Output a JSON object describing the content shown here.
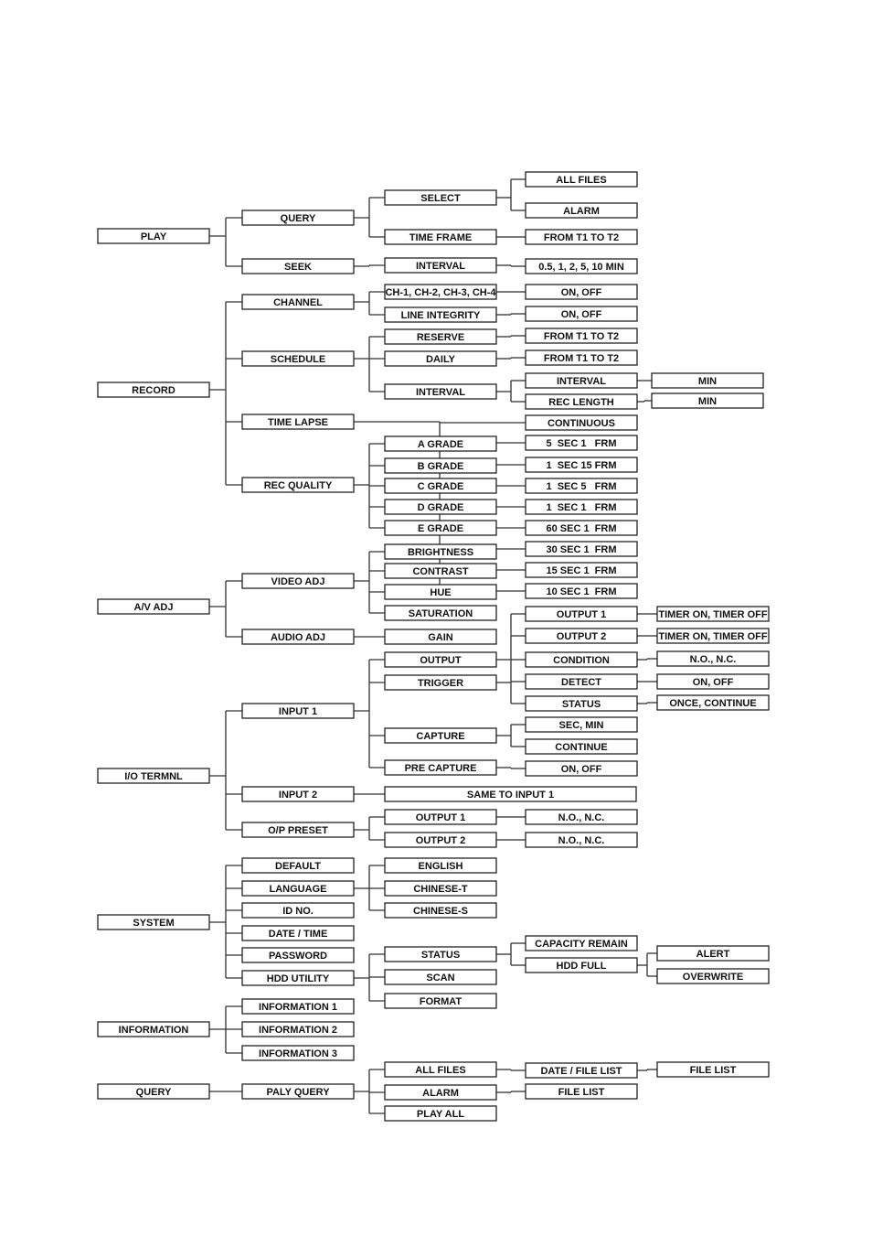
{
  "diagram": {
    "type": "menu-tree",
    "nodes": [
      {
        "id": "play",
        "label": "PLAY",
        "parent": null
      },
      {
        "id": "p_query",
        "label": "QUERY",
        "parent": "play"
      },
      {
        "id": "p_seek",
        "label": "SEEK",
        "parent": "play"
      },
      {
        "id": "p_select",
        "label": "SELECT",
        "parent": "p_query"
      },
      {
        "id": "p_timeframe",
        "label": "TIME FRAME",
        "parent": "p_query"
      },
      {
        "id": "p_allfiles",
        "label": "ALL FILES",
        "parent": "p_select"
      },
      {
        "id": "p_alarm",
        "label": "ALARM",
        "parent": "p_select"
      },
      {
        "id": "p_t1t2",
        "label": "FROM T1 TO T2",
        "parent": "p_timeframe"
      },
      {
        "id": "p_interval",
        "label": "INTERVAL",
        "parent": "p_seek"
      },
      {
        "id": "p_intv",
        "label": "0.5, 1, 2, 5, 10 MIN",
        "parent": "p_interval"
      },
      {
        "id": "record",
        "label": "RECORD",
        "parent": null
      },
      {
        "id": "r_channel",
        "label": "CHANNEL",
        "parent": "record"
      },
      {
        "id": "r_schedule",
        "label": "SCHEDULE",
        "parent": "record"
      },
      {
        "id": "r_timelapse",
        "label": "TIME LAPSE",
        "parent": "record"
      },
      {
        "id": "r_recq",
        "label": "REC QUALITY",
        "parent": "record"
      },
      {
        "id": "r_ch",
        "label": "CH-1, CH-2, CH-3, CH-4",
        "parent": "r_channel"
      },
      {
        "id": "r_line",
        "label": "LINE INTEGRITY",
        "parent": "r_channel"
      },
      {
        "id": "r_chonoff",
        "label": "ON, OFF",
        "parent": "r_ch"
      },
      {
        "id": "r_lineonoff",
        "label": "ON, OFF",
        "parent": "r_line"
      },
      {
        "id": "r_reserve",
        "label": "RESERVE",
        "parent": "r_schedule"
      },
      {
        "id": "r_daily",
        "label": "DAILY",
        "parent": "r_schedule"
      },
      {
        "id": "r_sint",
        "label": "INTERVAL",
        "parent": "r_schedule"
      },
      {
        "id": "r_reservet",
        "label": "FROM T1 TO T2",
        "parent": "r_reserve"
      },
      {
        "id": "r_dailyt",
        "label": "FROM T1 TO T2",
        "parent": "r_daily"
      },
      {
        "id": "r_iint",
        "label": "INTERVAL",
        "parent": "r_sint"
      },
      {
        "id": "r_ireclen",
        "label": "REC LENGTH",
        "parent": "r_sint"
      },
      {
        "id": "r_min1",
        "label": "MIN",
        "parent": "r_iint"
      },
      {
        "id": "r_min2",
        "label": "MIN",
        "parent": "r_ireclen"
      },
      {
        "id": "t0",
        "label": "CONTINUOUS",
        "parent": "r_timelapse"
      },
      {
        "id": "t1",
        "label": "5  SEC 1   FRM",
        "parent": "r_timelapse"
      },
      {
        "id": "t2",
        "label": "1  SEC 15 FRM",
        "parent": "r_timelapse"
      },
      {
        "id": "t3",
        "label": "1  SEC 5   FRM",
        "parent": "r_timelapse"
      },
      {
        "id": "t4",
        "label": "1  SEC 1   FRM",
        "parent": "r_timelapse"
      },
      {
        "id": "t5",
        "label": "60 SEC 1  FRM",
        "parent": "r_timelapse"
      },
      {
        "id": "t6",
        "label": "30 SEC 1  FRM",
        "parent": "r_timelapse"
      },
      {
        "id": "t7",
        "label": "15 SEC 1  FRM",
        "parent": "r_timelapse"
      },
      {
        "id": "t8",
        "label": "10 SEC 1  FRM",
        "parent": "r_timelapse"
      },
      {
        "id": "g_a",
        "label": "A GRADE",
        "parent": "r_recq"
      },
      {
        "id": "g_b",
        "label": "B GRADE",
        "parent": "r_recq"
      },
      {
        "id": "g_c",
        "label": "C GRADE",
        "parent": "r_recq"
      },
      {
        "id": "g_d",
        "label": "D GRADE",
        "parent": "r_recq"
      },
      {
        "id": "g_e",
        "label": "E GRADE",
        "parent": "r_recq"
      },
      {
        "id": "av",
        "label": "A/V ADJ",
        "parent": null
      },
      {
        "id": "a_video",
        "label": "VIDEO ADJ",
        "parent": "av"
      },
      {
        "id": "a_audio",
        "label": "AUDIO ADJ",
        "parent": "av"
      },
      {
        "id": "a_bright",
        "label": "BRIGHTNESS",
        "parent": "a_video"
      },
      {
        "id": "a_contrast",
        "label": "CONTRAST",
        "parent": "a_video"
      },
      {
        "id": "a_hue",
        "label": "HUE",
        "parent": "a_video"
      },
      {
        "id": "a_sat",
        "label": "SATURATION",
        "parent": "a_video"
      },
      {
        "id": "a_gain",
        "label": "GAIN",
        "parent": "a_audio"
      },
      {
        "id": "io",
        "label": "I/O TERMNL",
        "parent": null
      },
      {
        "id": "i_in1",
        "label": "INPUT 1",
        "parent": "io"
      },
      {
        "id": "i_in2",
        "label": "INPUT 2",
        "parent": "io"
      },
      {
        "id": "i_op",
        "label": "O/P PRESET",
        "parent": "io"
      },
      {
        "id": "i_output",
        "label": "OUTPUT",
        "parent": "i_in1"
      },
      {
        "id": "i_trigger",
        "label": "TRIGGER",
        "parent": "i_in1"
      },
      {
        "id": "i_capture",
        "label": "CAPTURE",
        "parent": "i_in1"
      },
      {
        "id": "i_precap",
        "label": "PRE CAPTURE",
        "parent": "i_in1"
      },
      {
        "id": "i_out1",
        "label": "OUTPUT 1",
        "parent": "i_output"
      },
      {
        "id": "i_out2",
        "label": "OUTPUT 2",
        "parent": "i_output"
      },
      {
        "id": "i_timer1",
        "label": "TIMER ON, TIMER OFF",
        "parent": "i_out1"
      },
      {
        "id": "i_timer2",
        "label": "TIMER ON, TIMER OFF",
        "parent": "i_out2"
      },
      {
        "id": "i_cond",
        "label": "CONDITION",
        "parent": "i_trigger"
      },
      {
        "id": "i_detect",
        "label": "DETECT",
        "parent": "i_trigger"
      },
      {
        "id": "i_status",
        "label": "STATUS",
        "parent": "i_trigger"
      },
      {
        "id": "i_nonc",
        "label": "N.O., N.C.",
        "parent": "i_cond"
      },
      {
        "id": "i_onoff",
        "label": "ON, OFF",
        "parent": "i_detect"
      },
      {
        "id": "i_once",
        "label": "ONCE, CONTINUE",
        "parent": "i_status"
      },
      {
        "id": "i_secmin",
        "label": "SEC, MIN",
        "parent": "i_capture"
      },
      {
        "id": "i_cont",
        "label": "CONTINUE",
        "parent": "i_capture"
      },
      {
        "id": "i_preonoff",
        "label": "ON, OFF",
        "parent": "i_precap"
      },
      {
        "id": "i_same",
        "label": "SAME TO INPUT 1",
        "parent": "i_in2"
      },
      {
        "id": "i_po1",
        "label": "OUTPUT 1",
        "parent": "i_op"
      },
      {
        "id": "i_po2",
        "label": "OUTPUT 2",
        "parent": "i_op"
      },
      {
        "id": "i_po1n",
        "label": "N.O., N.C.",
        "parent": "i_po1"
      },
      {
        "id": "i_po2n",
        "label": "N.O., N.C.",
        "parent": "i_po2"
      },
      {
        "id": "sys",
        "label": "SYSTEM",
        "parent": null
      },
      {
        "id": "s_default",
        "label": "DEFAULT",
        "parent": "sys"
      },
      {
        "id": "s_lang",
        "label": "LANGUAGE",
        "parent": "sys"
      },
      {
        "id": "s_id",
        "label": "ID NO.",
        "parent": "sys"
      },
      {
        "id": "s_date",
        "label": "DATE / TIME",
        "parent": "sys"
      },
      {
        "id": "s_pwd",
        "label": "PASSWORD",
        "parent": "sys"
      },
      {
        "id": "s_hdd",
        "label": "HDD UTILITY",
        "parent": "sys"
      },
      {
        "id": "s_en",
        "label": "ENGLISH",
        "parent": "s_lang"
      },
      {
        "id": "s_ct",
        "label": "CHINESE-T",
        "parent": "s_lang"
      },
      {
        "id": "s_cs",
        "label": "CHINESE-S",
        "parent": "s_lang"
      },
      {
        "id": "s_status",
        "label": "STATUS",
        "parent": "s_hdd"
      },
      {
        "id": "s_scan",
        "label": "SCAN",
        "parent": "s_hdd"
      },
      {
        "id": "s_format",
        "label": "FORMAT",
        "parent": "s_hdd"
      },
      {
        "id": "s_cap",
        "label": "CAPACITY REMAIN",
        "parent": "s_status"
      },
      {
        "id": "s_full",
        "label": "HDD FULL",
        "parent": "s_status"
      },
      {
        "id": "s_alert",
        "label": "ALERT",
        "parent": "s_full"
      },
      {
        "id": "s_over",
        "label": "OVERWRITE",
        "parent": "s_full"
      },
      {
        "id": "info",
        "label": "INFORMATION",
        "parent": null
      },
      {
        "id": "n_1",
        "label": "INFORMATION 1",
        "parent": "info"
      },
      {
        "id": "n_2",
        "label": "INFORMATION 2",
        "parent": "info"
      },
      {
        "id": "n_3",
        "label": "INFORMATION 3",
        "parent": "info"
      },
      {
        "id": "q",
        "label": "QUERY",
        "parent": null
      },
      {
        "id": "q_paly",
        "label": "PALY QUERY",
        "parent": "q"
      },
      {
        "id": "q_all",
        "label": "ALL FILES",
        "parent": "q_paly"
      },
      {
        "id": "q_alarm",
        "label": "ALARM",
        "parent": "q_paly"
      },
      {
        "id": "q_playall",
        "label": "PLAY ALL",
        "parent": "q_paly"
      },
      {
        "id": "q_datelist",
        "label": "DATE / FILE LIST",
        "parent": "q_all"
      },
      {
        "id": "q_fl1",
        "label": "FILE LIST",
        "parent": "q_datelist"
      },
      {
        "id": "q_fl2",
        "label": "FILE LIST",
        "parent": "q_alarm"
      }
    ]
  }
}
